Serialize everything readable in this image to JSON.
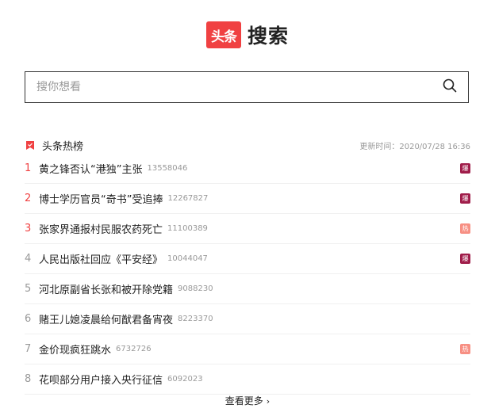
{
  "brand": {
    "logo_text": "头条",
    "title": "搜索",
    "accent": "#f04142"
  },
  "search": {
    "placeholder": "搜你想看",
    "value": ""
  },
  "hot": {
    "title": "头条热榜",
    "update_label": "更新时间：",
    "update_time": "2020/07/28 16:36",
    "items": [
      {
        "rank": "1",
        "title": "黄之锋否认“港独”主张",
        "count": "13558046",
        "badge": "爆",
        "badge_type": "bao"
      },
      {
        "rank": "2",
        "title": "博士学历官员“奇书”受追捧",
        "count": "12267827",
        "badge": "爆",
        "badge_type": "bao"
      },
      {
        "rank": "3",
        "title": "张家界通报村民服农药死亡",
        "count": "11100389",
        "badge": "热",
        "badge_type": "re"
      },
      {
        "rank": "4",
        "title": "人民出版社回应《平安经》",
        "count": "10044047",
        "badge": "爆",
        "badge_type": "bao"
      },
      {
        "rank": "5",
        "title": "河北原副省长张和被开除党籍",
        "count": "9088230",
        "badge": "",
        "badge_type": ""
      },
      {
        "rank": "6",
        "title": "赌王儿媳凌晨给何猷君备宵夜",
        "count": "8223370",
        "badge": "",
        "badge_type": ""
      },
      {
        "rank": "7",
        "title": "金价现疯狂跳水",
        "count": "6732726",
        "badge": "热",
        "badge_type": "re"
      },
      {
        "rank": "8",
        "title": "花呗部分用户接入央行征信",
        "count": "6092023",
        "badge": "",
        "badge_type": ""
      }
    ]
  },
  "more": {
    "label": "查看更多",
    "chevron": "›"
  },
  "icons": {
    "logo": "toutiao-logo",
    "search": "search-icon",
    "hot_flag": "flag-icon"
  },
  "colors": {
    "rank_top": "#f04142",
    "badge_bao": "#a01d4a",
    "badge_re": "#f78f83"
  }
}
